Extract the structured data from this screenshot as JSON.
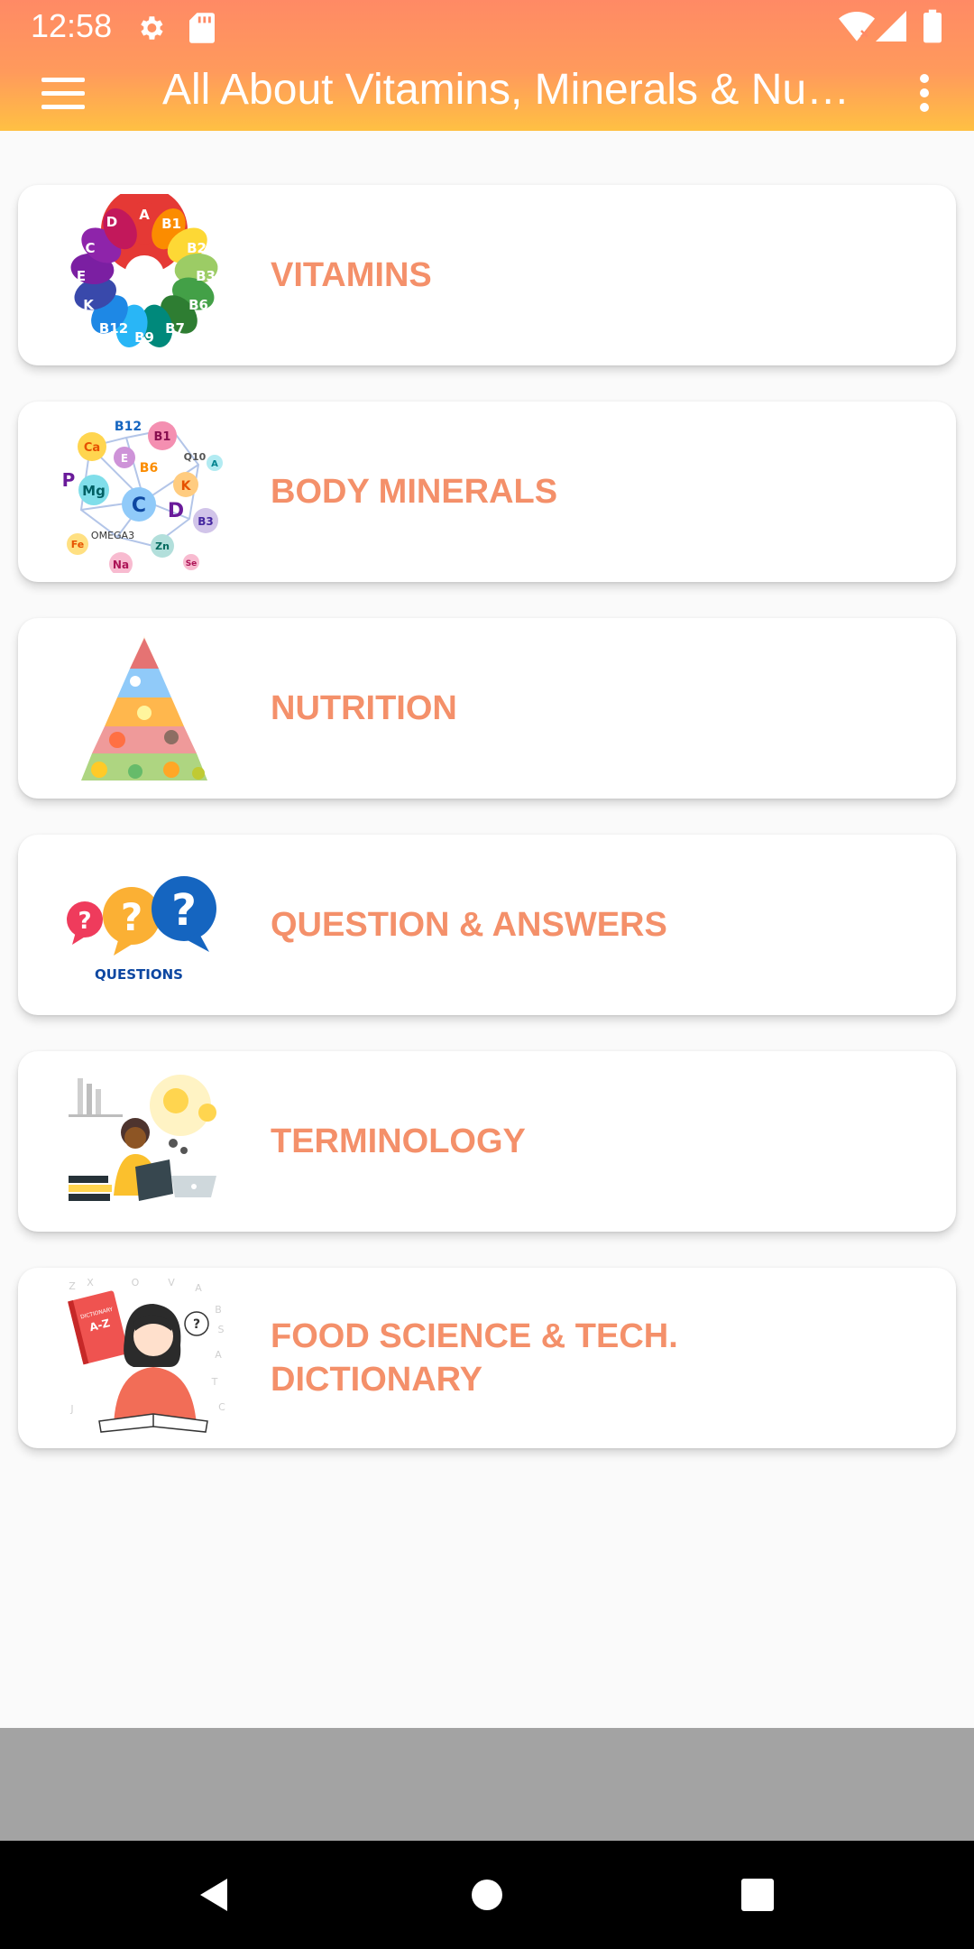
{
  "status_bar": {
    "time": "12:58",
    "icons": [
      "settings-icon",
      "sd-card-icon",
      "wifi-icon",
      "signal-icon",
      "battery-icon"
    ]
  },
  "toolbar": {
    "title": "All About Vitamins, Minerals & Nutrition",
    "menu_icon": "hamburger-menu-icon",
    "overflow_icon": "more-vert-icon"
  },
  "categories": [
    {
      "label": "VITAMINS",
      "icon": "vitamins-wheel-icon"
    },
    {
      "label": "BODY MINERALS",
      "icon": "minerals-molecule-icon"
    },
    {
      "label": "NUTRITION",
      "icon": "food-pyramid-icon"
    },
    {
      "label": "QUESTION & ANSWERS",
      "icon": "question-bubbles-icon"
    },
    {
      "label": "TERMINOLOGY",
      "icon": "reading-person-icon"
    },
    {
      "label": "FOOD SCIENCE & TECH.\nDICTIONARY",
      "icon": "dictionary-reader-icon"
    }
  ],
  "thumb_text": {
    "vitamins_letters": [
      "A",
      "B1",
      "B2",
      "B3",
      "B5",
      "B6",
      "B7",
      "B9",
      "B12",
      "K",
      "E",
      "C",
      "D"
    ],
    "minerals_letters": [
      "B12",
      "B1",
      "Ca",
      "E",
      "B6",
      "Q10",
      "A",
      "P",
      "Mg",
      "C",
      "K",
      "D",
      "B3",
      "Fe",
      "OMEGA3",
      "Zn",
      "Na",
      "Se"
    ],
    "questions_caption": "QUESTIONS",
    "dictionary_cover": "A-Z",
    "dictionary_header": "DICTIONARY"
  },
  "colors": {
    "header_top": "#ff8a65",
    "header_bottom": "#ffc043",
    "accent_text": "#f4906a",
    "ad_placeholder": "#a3a3a3",
    "nav_bar": "#000000"
  },
  "nav": [
    "back-icon",
    "home-icon",
    "recents-icon"
  ]
}
